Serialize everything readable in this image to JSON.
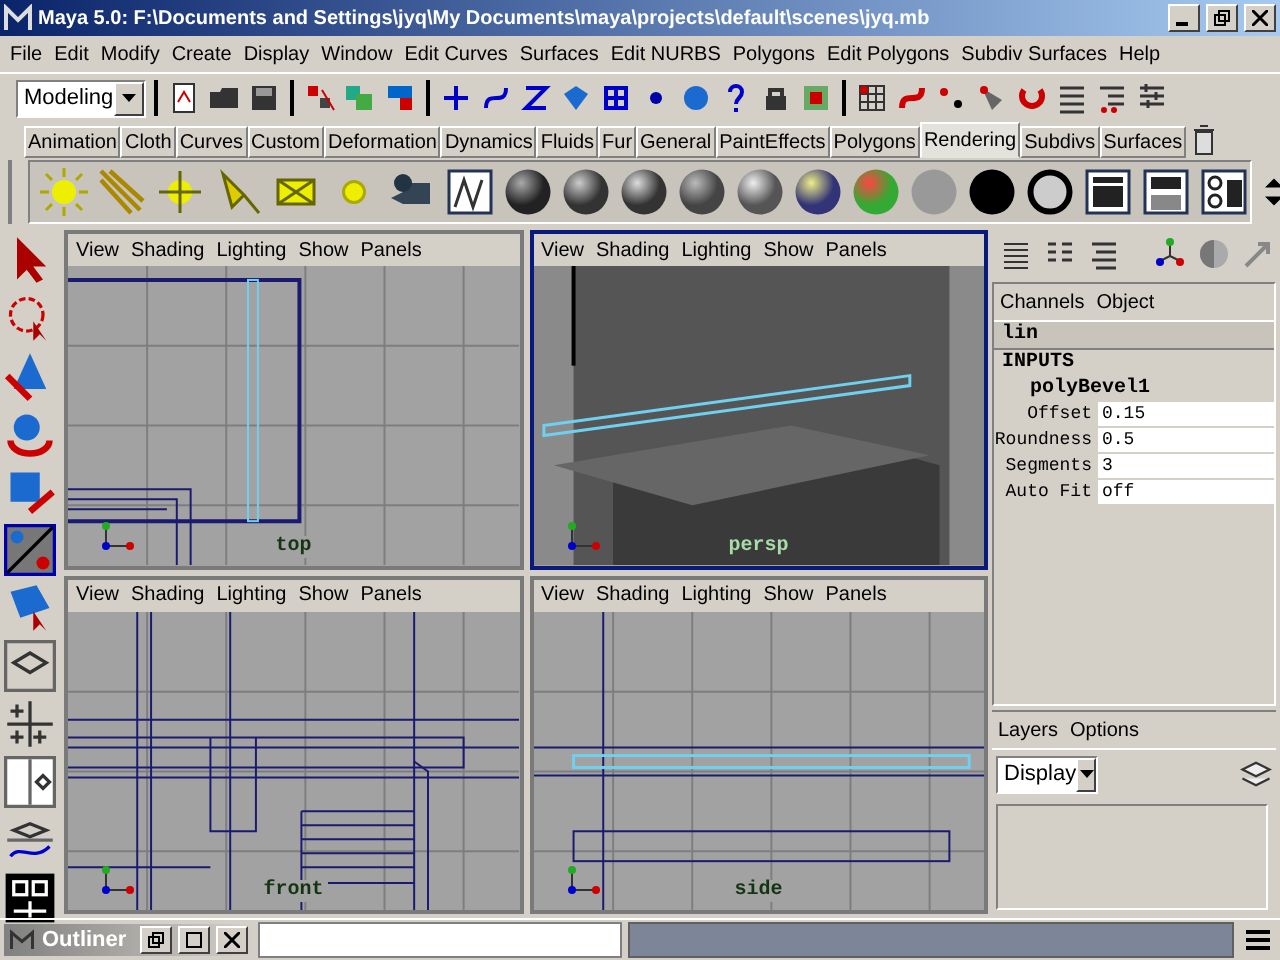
{
  "window": {
    "title": "Maya 5.0: F:\\Documents and Settings\\jyq\\My Documents\\maya\\projects\\default\\scenes\\jyq.mb"
  },
  "menu": [
    "File",
    "Edit",
    "Modify",
    "Create",
    "Display",
    "Window",
    "Edit Curves",
    "Surfaces",
    "Edit NURBS",
    "Polygons",
    "Edit Polygons",
    "Subdiv Surfaces",
    "Help"
  ],
  "mode": {
    "value": "Modeling"
  },
  "shelf_tabs": [
    {
      "label": "Animation",
      "selected": false
    },
    {
      "label": "Cloth",
      "selected": false
    },
    {
      "label": "Curves",
      "selected": false
    },
    {
      "label": "Custom",
      "selected": false
    },
    {
      "label": "Deformation",
      "selected": false
    },
    {
      "label": "Dynamics",
      "selected": false
    },
    {
      "label": "Fluids",
      "selected": false
    },
    {
      "label": "Fur",
      "selected": false
    },
    {
      "label": "General",
      "selected": false
    },
    {
      "label": "PaintEffects",
      "selected": false
    },
    {
      "label": "Polygons",
      "selected": false
    },
    {
      "label": "Rendering",
      "selected": true
    },
    {
      "label": "Subdivs",
      "selected": false
    },
    {
      "label": "Surfaces",
      "selected": false
    }
  ],
  "viewports": [
    {
      "kind": "top",
      "menu": [
        "View",
        "Shading",
        "Lighting",
        "Show",
        "Panels"
      ],
      "camera": "top",
      "selected": false
    },
    {
      "kind": "persp",
      "menu": [
        "View",
        "Shading",
        "Lighting",
        "Show",
        "Panels"
      ],
      "camera": "persp",
      "selected": true
    },
    {
      "kind": "front",
      "menu": [
        "View",
        "Shading",
        "Lighting",
        "Show",
        "Panels"
      ],
      "camera": "front",
      "selected": false
    },
    {
      "kind": "side",
      "menu": [
        "View",
        "Shading",
        "Lighting",
        "Show",
        "Panels"
      ],
      "camera": "side",
      "selected": false
    }
  ],
  "channel_box": {
    "tabs": [
      "Channels",
      "Object"
    ],
    "node": "lin",
    "section": "INPUTS",
    "input": "polyBevel1",
    "attributes": [
      {
        "name": "Offset",
        "value": "0.15"
      },
      {
        "name": "Roundness",
        "value": "0.5"
      },
      {
        "name": "Segments",
        "value": "3"
      },
      {
        "name": "Auto Fit",
        "value": "off"
      }
    ]
  },
  "layers": {
    "menu": [
      "Layers",
      "Options"
    ],
    "mode": "Display"
  },
  "outliner": {
    "title": "Outliner"
  }
}
